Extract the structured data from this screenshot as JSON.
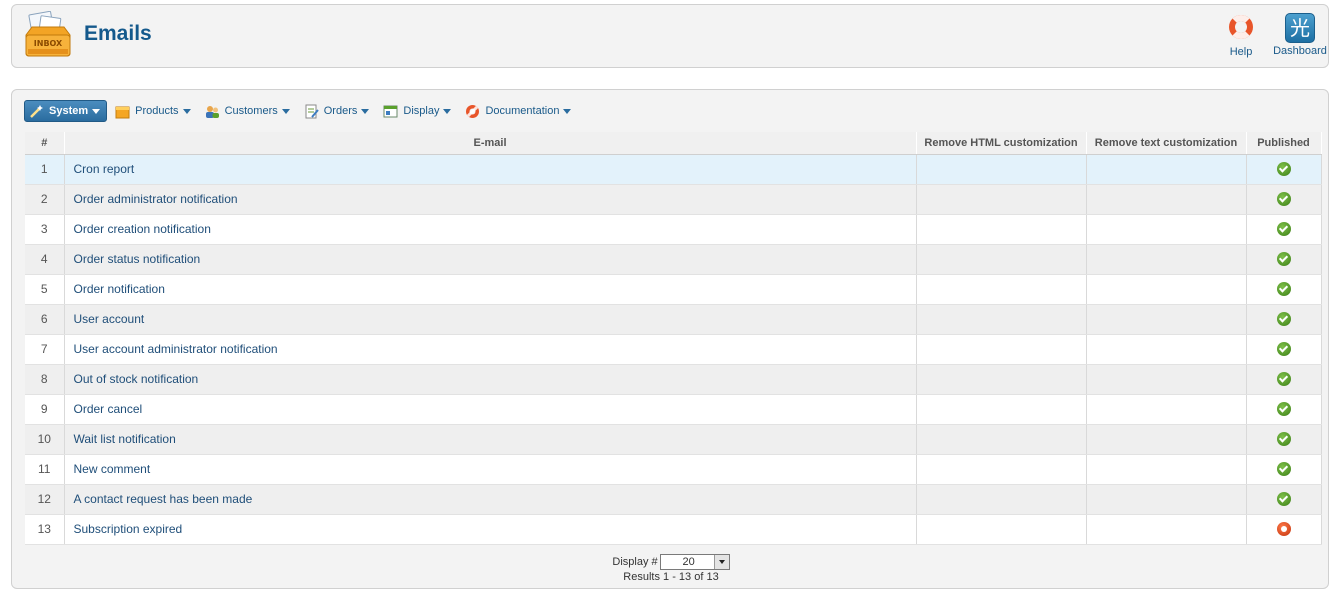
{
  "header": {
    "title": "Emails",
    "inbox_icon_text": "INBOX",
    "help_label": "Help",
    "dashboard_label": "Dashboard",
    "dashboard_glyph": "光"
  },
  "menu": {
    "items": [
      {
        "label": "System",
        "icon": "wand-icon",
        "active": true
      },
      {
        "label": "Products",
        "icon": "box-icon"
      },
      {
        "label": "Customers",
        "icon": "users-icon"
      },
      {
        "label": "Orders",
        "icon": "order-icon"
      },
      {
        "label": "Display",
        "icon": "display-icon"
      },
      {
        "label": "Documentation",
        "icon": "lifebuoy-icon"
      }
    ]
  },
  "table": {
    "columns": [
      "#",
      "E-mail",
      "Remove HTML customization",
      "Remove text customization",
      "Published"
    ],
    "rows": [
      {
        "num": "1",
        "email": "Cron report",
        "published": true
      },
      {
        "num": "2",
        "email": "Order administrator notification",
        "published": true
      },
      {
        "num": "3",
        "email": "Order creation notification",
        "published": true
      },
      {
        "num": "4",
        "email": "Order status notification",
        "published": true
      },
      {
        "num": "5",
        "email": "Order notification",
        "published": true
      },
      {
        "num": "6",
        "email": "User account",
        "published": true
      },
      {
        "num": "7",
        "email": "User account administrator notification",
        "published": true
      },
      {
        "num": "8",
        "email": "Out of stock notification",
        "published": true
      },
      {
        "num": "9",
        "email": "Order cancel",
        "published": true
      },
      {
        "num": "10",
        "email": "Wait list notification",
        "published": true
      },
      {
        "num": "11",
        "email": "New comment",
        "published": true
      },
      {
        "num": "12",
        "email": "A contact request has been made",
        "published": true
      },
      {
        "num": "13",
        "email": "Subscription expired",
        "published": false
      }
    ]
  },
  "footer": {
    "display_label": "Display #",
    "display_value": "20",
    "results_text": "Results 1 - 13 of 13"
  },
  "colors": {
    "title": "#14598c",
    "link": "#1f4e79",
    "published": "#3c7f16",
    "unpublished": "#c2330c",
    "highlight_row": "#e3f2fb"
  }
}
